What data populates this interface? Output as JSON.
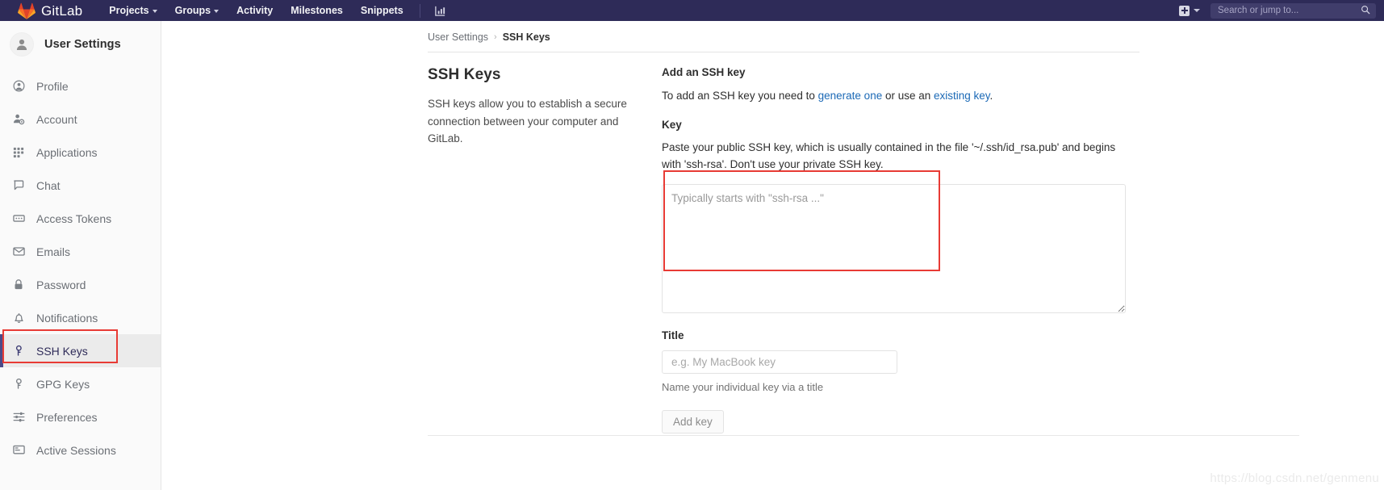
{
  "navbar": {
    "brand": "GitLab",
    "brand_icon": "gitlab-tanuki-logo",
    "links": [
      {
        "label": "Projects",
        "has_caret": true
      },
      {
        "label": "Groups",
        "has_caret": true
      },
      {
        "label": "Activity",
        "has_caret": false
      },
      {
        "label": "Milestones",
        "has_caret": false
      },
      {
        "label": "Snippets",
        "has_caret": false
      }
    ],
    "chart_icon": "analytics-chart-icon",
    "plus_icon": "plus-square-icon",
    "plus_caret_icon": "chevron-down-icon",
    "search": {
      "placeholder": "Search or jump to...",
      "value": "",
      "icon": "search-icon"
    },
    "bg_color": "#2e2b58"
  },
  "sidebar": {
    "header": {
      "title": "User Settings",
      "avatar_icon": "user-avatar-icon"
    },
    "items": [
      {
        "label": "Profile",
        "icon": "user-circle-icon",
        "active": false
      },
      {
        "label": "Account",
        "icon": "user-gear-icon",
        "active": false
      },
      {
        "label": "Applications",
        "icon": "grid-apps-icon",
        "active": false
      },
      {
        "label": "Chat",
        "icon": "chat-bubble-icon",
        "active": false
      },
      {
        "label": "Access Tokens",
        "icon": "token-card-icon",
        "active": false
      },
      {
        "label": "Emails",
        "icon": "envelope-icon",
        "active": false
      },
      {
        "label": "Password",
        "icon": "lock-icon",
        "active": false
      },
      {
        "label": "Notifications",
        "icon": "bell-icon",
        "active": false
      },
      {
        "label": "SSH Keys",
        "icon": "key-icon",
        "active": true
      },
      {
        "label": "GPG Keys",
        "icon": "key-icon",
        "active": false
      },
      {
        "label": "Preferences",
        "icon": "sliders-icon",
        "active": false
      },
      {
        "label": "Active Sessions",
        "icon": "monitor-icon",
        "active": false
      }
    ],
    "active_indicator_color": "#4b4a89"
  },
  "breadcrumb": {
    "parent": "User Settings",
    "separator": "›",
    "current": "SSH Keys"
  },
  "main": {
    "left": {
      "heading": "SSH Keys",
      "description": "SSH keys allow you to establish a secure connection between your computer and GitLab."
    },
    "form": {
      "heading": "Add an SSH key",
      "intro_prefix": "To add an SSH key you need to ",
      "intro_link1": "generate one",
      "intro_middle": " or use an ",
      "intro_link2": "existing key",
      "intro_suffix": ".",
      "key_label": "Key",
      "key_help": "Paste your public SSH key, which is usually contained in the file '~/.ssh/id_rsa.pub' and begins with 'ssh-rsa'. Don't use your private SSH key.",
      "key_placeholder": "Typically starts with \"ssh-rsa ...\"",
      "key_value": "",
      "title_label": "Title",
      "title_placeholder": "e.g. My MacBook key",
      "title_value": "",
      "title_hint": "Name your individual key via a title",
      "submit_label": "Add key"
    }
  },
  "annotations": {
    "highlight_color": "#e83b35",
    "boxes": [
      {
        "target": "sidebar-item-ssh-keys"
      },
      {
        "target": "ssh-key-textarea"
      }
    ]
  },
  "watermark": {
    "text": "https://blog.csdn.net/genmenu"
  }
}
